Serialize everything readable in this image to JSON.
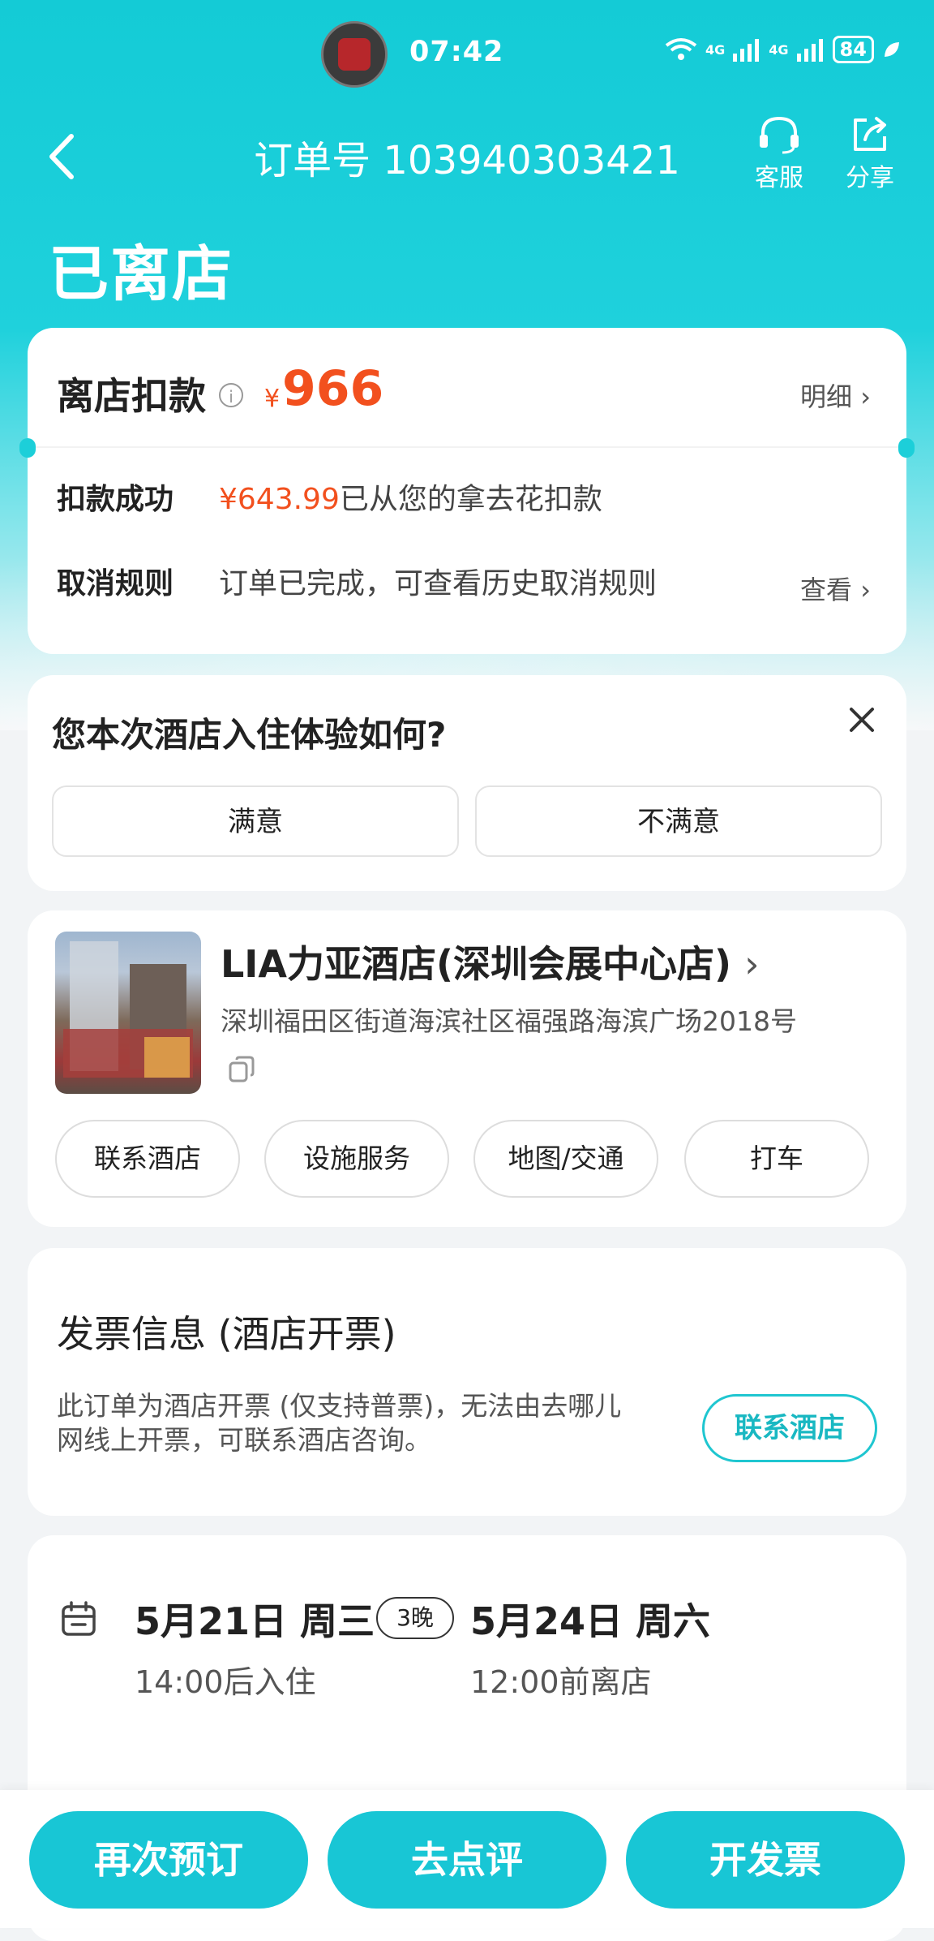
{
  "status_bar": {
    "time": "07:42",
    "network1": "4G",
    "network2": "4G",
    "battery": "84"
  },
  "nav": {
    "order_no": "订单号 103940303421",
    "service_label": "客服",
    "share_label": "分享"
  },
  "page_title": "已离店",
  "settlement": {
    "title": "离店扣款",
    "currency": "¥",
    "amount": "966",
    "detail_link": "明细",
    "deduct_label": "扣款成功",
    "deduct_amount": "¥643.99",
    "deduct_text": "已从您的拿去花扣款",
    "cancel_label": "取消规则",
    "cancel_text": "订单已完成，可查看历史取消规则",
    "view_link": "查看"
  },
  "survey": {
    "question": "您本次酒店入住体验如何?",
    "satisfied": "满意",
    "unsatisfied": "不满意"
  },
  "hotel": {
    "name": "LIA力亚酒店(深圳会展中心店)",
    "address": "深圳福田区街道海滨社区福强路海滨广场2018号",
    "actions": [
      "联系酒店",
      "设施服务",
      "地图/交通",
      "打车"
    ]
  },
  "invoice": {
    "title": "发票信息 (酒店开票)",
    "desc_line1": "此订单为酒店开票 (仅支持普票)，无法由去哪儿",
    "desc_line2": "网线上开票，可联系酒店咨询。",
    "contact_button": "联系酒店"
  },
  "stay": {
    "checkin_date": "5月21日 周三",
    "nights": "3晚",
    "checkout_date": "5月24日 周六",
    "checkin_time": "14:00后入住",
    "checkout_time": "12:00前离店"
  },
  "bottom_bar": {
    "rebook": "再次预订",
    "review": "去点评",
    "invoice": "开发票"
  },
  "colors": {
    "accent": "#18c6d5",
    "price": "#f2501e"
  }
}
